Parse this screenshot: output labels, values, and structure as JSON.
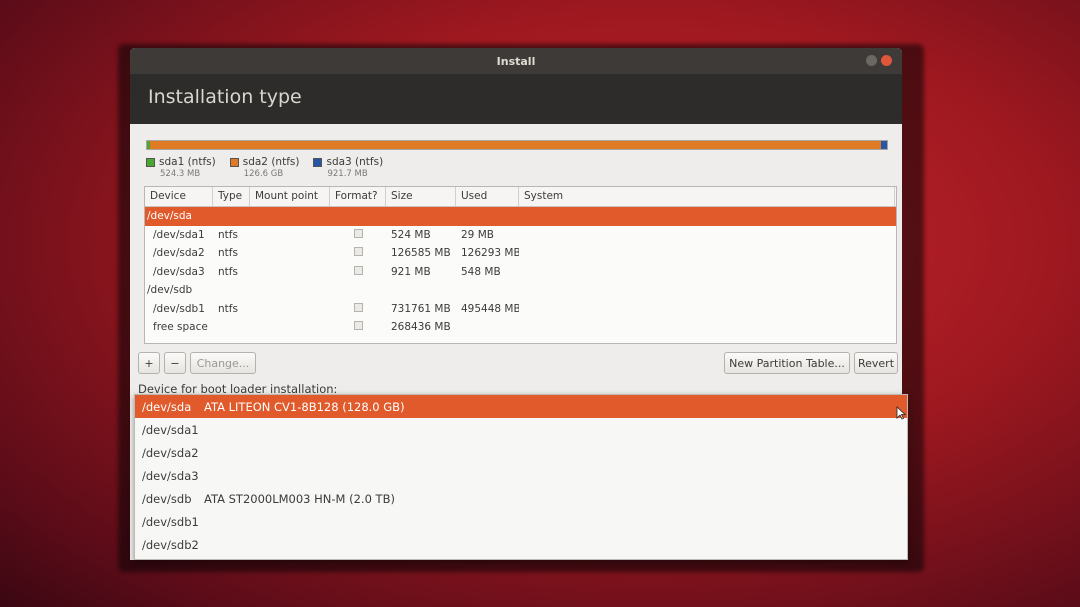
{
  "window": {
    "title": "Install",
    "header_title": "Installation type"
  },
  "partition_bar": {
    "segments": [
      {
        "name": "sda1",
        "color": "#4aa832",
        "fraction": 0.004
      },
      {
        "name": "sda2",
        "color": "#e07b25",
        "fraction": 0.988
      },
      {
        "name": "sda3",
        "color": "#2656a8",
        "fraction": 0.008
      }
    ]
  },
  "legend": [
    {
      "label": "sda1 (ntfs)",
      "size": "524.3 MB",
      "color": "#4aa832"
    },
    {
      "label": "sda2 (ntfs)",
      "size": "126.6 GB",
      "color": "#e07b25"
    },
    {
      "label": "sda3 (ntfs)",
      "size": "921.7 MB",
      "color": "#2656a8"
    }
  ],
  "table": {
    "columns": [
      "Device",
      "Type",
      "Mount point",
      "Format?",
      "Size",
      "Used",
      "System"
    ],
    "rows": [
      {
        "device": "/dev/sda",
        "type": "",
        "mount": "",
        "format": false,
        "size": "",
        "used": "",
        "system": "",
        "selected": true,
        "is_disk": true
      },
      {
        "device": "/dev/sda1",
        "type": "ntfs",
        "mount": "",
        "format": true,
        "size": "524 MB",
        "used": "29 MB",
        "system": ""
      },
      {
        "device": "/dev/sda2",
        "type": "ntfs",
        "mount": "",
        "format": true,
        "size": "126585 MB",
        "used": "126293 MB",
        "system": ""
      },
      {
        "device": "/dev/sda3",
        "type": "ntfs",
        "mount": "",
        "format": true,
        "size": "921 MB",
        "used": "548 MB",
        "system": ""
      },
      {
        "device": "/dev/sdb",
        "type": "",
        "mount": "",
        "format": false,
        "size": "",
        "used": "",
        "system": "",
        "is_disk": true
      },
      {
        "device": "/dev/sdb1",
        "type": "ntfs",
        "mount": "",
        "format": true,
        "size": "731761 MB",
        "used": "495448 MB",
        "system": ""
      },
      {
        "device": "free space",
        "type": "",
        "mount": "",
        "format": true,
        "size": "268436 MB",
        "used": "",
        "system": ""
      }
    ]
  },
  "buttons": {
    "add": "+",
    "remove": "−",
    "change": "Change...",
    "new_partition_table": "New Partition Table...",
    "revert": "Revert"
  },
  "boot_loader": {
    "label": "Device for boot loader installation:",
    "options": [
      {
        "device": "/dev/sda",
        "desc": "ATA LITEON CV1-8B128 (128.0 GB)",
        "selected": true
      },
      {
        "device": "/dev/sda1",
        "desc": ""
      },
      {
        "device": "/dev/sda2",
        "desc": ""
      },
      {
        "device": "/dev/sda3",
        "desc": ""
      },
      {
        "device": "/dev/sdb",
        "desc": "ATA ST2000LM003 HN-M (2.0 TB)"
      },
      {
        "device": "/dev/sdb1",
        "desc": ""
      },
      {
        "device": "/dev/sdb2",
        "desc": ""
      }
    ]
  }
}
